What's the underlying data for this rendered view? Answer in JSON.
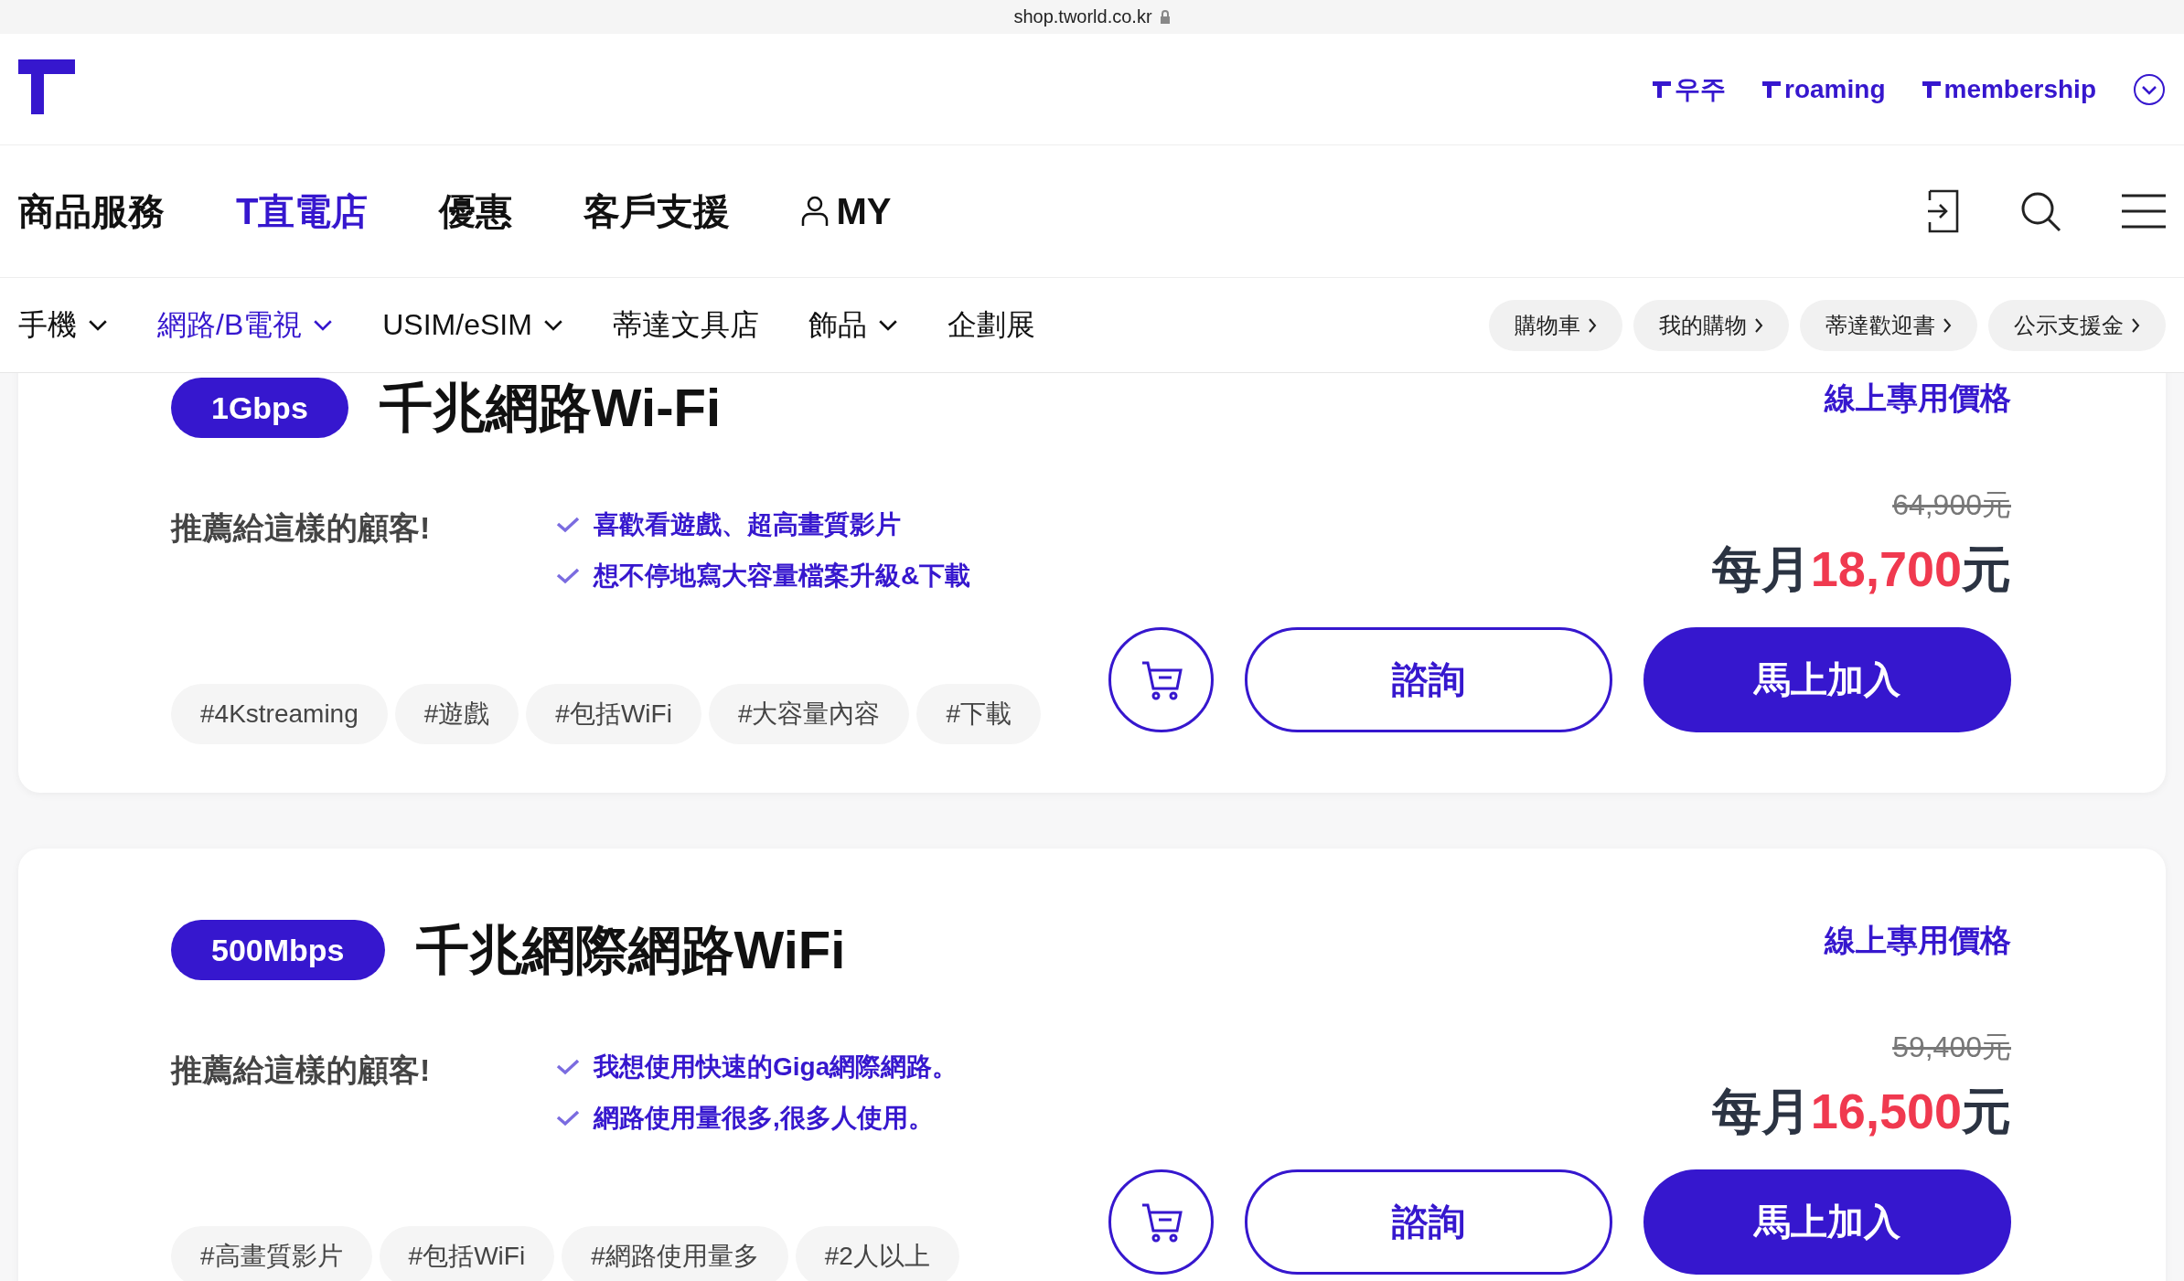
{
  "address_bar": {
    "url": "shop.tworld.co.kr"
  },
  "header_links": [
    {
      "label": "우주"
    },
    {
      "label": "roaming"
    },
    {
      "label": "membership"
    }
  ],
  "main_nav": [
    {
      "label": "商品服務",
      "selected": false,
      "kind": "text"
    },
    {
      "label": "T直電店",
      "selected": true,
      "kind": "text"
    },
    {
      "label": "優惠",
      "selected": false,
      "kind": "text"
    },
    {
      "label": "客戶支援",
      "selected": false,
      "kind": "text"
    },
    {
      "label": "MY",
      "selected": false,
      "kind": "account"
    }
  ],
  "sub_nav": [
    {
      "label": "手機",
      "selected": false,
      "dropdown": true
    },
    {
      "label": "網路/B電視",
      "selected": true,
      "dropdown": true
    },
    {
      "label": "USIM/eSIM",
      "selected": false,
      "dropdown": true
    },
    {
      "label": "蒂達文具店",
      "selected": false,
      "dropdown": false
    },
    {
      "label": "飾品",
      "selected": false,
      "dropdown": true
    },
    {
      "label": "企劃展",
      "selected": false,
      "dropdown": false
    }
  ],
  "quick_links": [
    "購物車",
    "我的購物",
    "蒂達歡迎書",
    "公示支援金"
  ],
  "products": [
    {
      "badge": "1Gbps",
      "title": "千兆網路Wi-Fi",
      "price_note": "線上專用價格",
      "recommend_label": "推薦給這樣的顧客!",
      "benefits": [
        "喜歡看遊戲、超高畫質影片",
        "想不停地寫大容量檔案升級&下載"
      ],
      "original_price": "64,900元",
      "price_prefix": "每月",
      "price": "18,700",
      "price_unit": "元",
      "tags": [
        "#4Kstreaming",
        "#遊戲",
        "#包括WiFi",
        "#大容量內容",
        "#下載"
      ],
      "consult_button": "諮詢",
      "join_button": "馬上加入"
    },
    {
      "badge": "500Mbps",
      "title": "千兆網際網路WiFi",
      "price_note": "線上專用價格",
      "recommend_label": "推薦給這樣的顧客!",
      "benefits": [
        "我想使用快速的Giga網際網路。",
        "網路使用量很多,很多人使用。"
      ],
      "original_price": "59,400元",
      "price_prefix": "每月",
      "price": "16,500",
      "price_unit": "元",
      "tags": [
        "#高畫質影片",
        "#包括WiFi",
        "#網路使用量多",
        "#2人以上"
      ],
      "consult_button": "諮詢",
      "join_button": "馬上加入"
    }
  ]
}
